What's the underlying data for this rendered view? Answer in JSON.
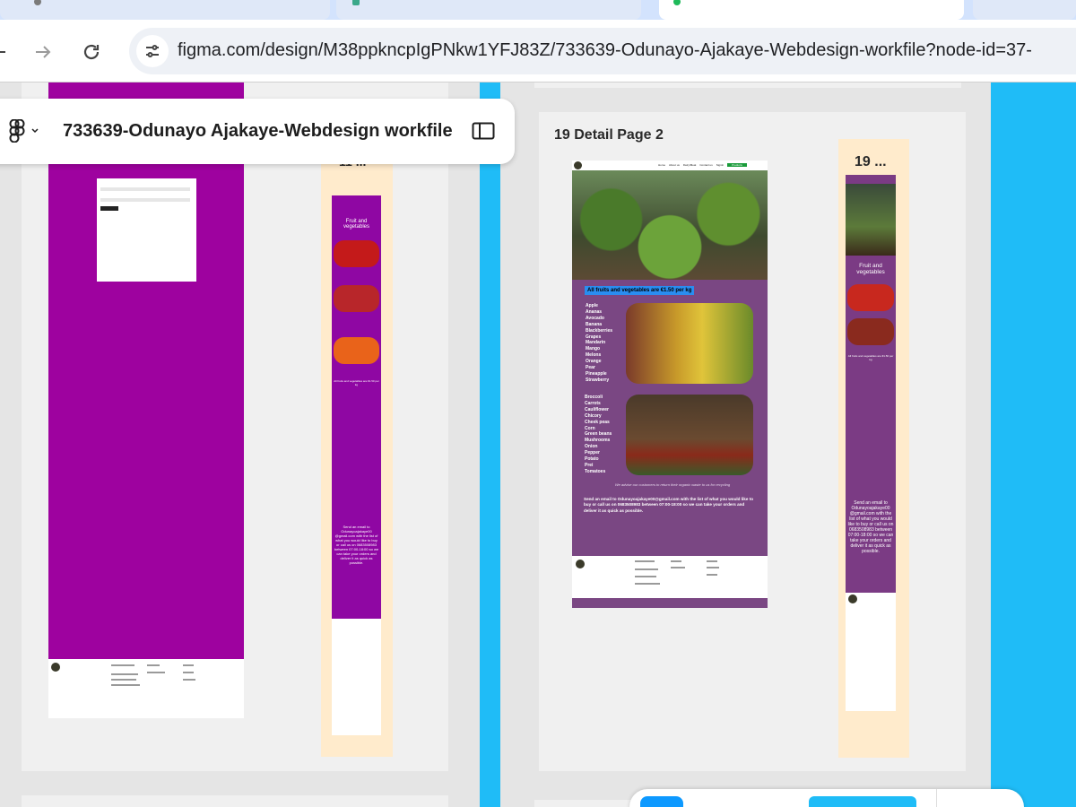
{
  "browser": {
    "url": "figma.com/design/M38ppkncpIgPNkw1YFJ83Z/733639-Odunayo-Ajakaye-Webdesign-workfile?node-id=37-"
  },
  "figma": {
    "file_title": "733639-Odunayo Ajakaye-Webdesign workfile"
  },
  "frames": {
    "left_mobile_label": "11 ...",
    "detail_label": "19 Detail Page 2",
    "detail_mobile_label": "19 ..."
  },
  "detail_page": {
    "nav": [
      "Home",
      "About us",
      "Dairy/Meat",
      "Contact us",
      "Signin"
    ],
    "nav_cta": "Products",
    "price_banner": "All fruits and vegetables are €1.50 per kg",
    "fruits": [
      "Apple",
      "Ananas",
      "Avocado",
      "Banana",
      "Blackberries",
      "Grapes",
      "Mandarin",
      "Mango",
      "Melons",
      "Orange",
      "Pear",
      "Pineapple",
      "Strawberry"
    ],
    "vegetables": [
      "Broccoli",
      "Carrots",
      "Cauliflower",
      "Chicory",
      "Cheek peas",
      "Corn",
      "Green beans",
      "Mushrooms",
      "Onion",
      "Pepper",
      "Potato",
      "Prei",
      "Tomatoes"
    ],
    "recycle_note": "We advise our customers to return their organic waste to us for recycling",
    "email_note": "Send an email to Odunayoajakaye00@gmail.com with the list of what you would like to buy or call us on 0683508983 between 07:00-18:00 so we can take your orders and deliver it as quick as possible."
  },
  "mobile_11": {
    "heading": "Fruit and vegetables",
    "price": "All fruits and vegetables are €1.50 per kg",
    "contact": "Send an email to Odunayoajakaye00 @gmail.com with the list of what you would like to buy or call us on 0683508983 between 07:00-18:00 so we can take your orders and deliver it as quick as possible."
  },
  "mobile_19": {
    "heading": "Fruit and vegetables",
    "price": "All fruits and vegetables are €1.50 per kg",
    "contact": "Send an email to Odunayoajakaye00 @gmail.com with the list of what you would like to buy or call us on 0683508983 between 07:00-18:00 so we can take your orders and deliver it as quick as possible."
  },
  "colors": {
    "canvas": "#e5e5e5",
    "accent_blue": "#1fbcf7",
    "purple": "#9e029f",
    "mobile_bg": "#ffebcc",
    "detail_purple": "#7a4783"
  }
}
